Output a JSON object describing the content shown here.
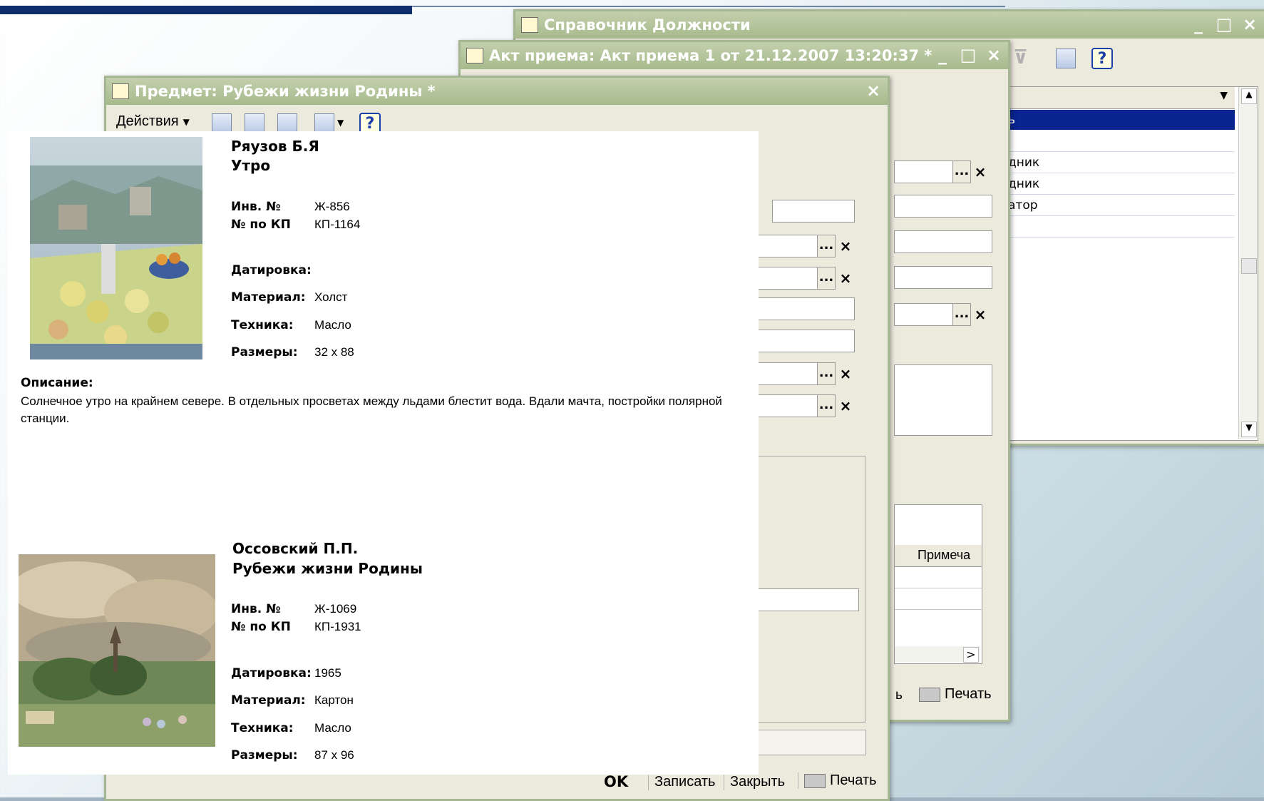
{
  "windows": {
    "sprav": {
      "title": "Справочник Должности",
      "list_items": [
        "ь",
        "",
        "дник",
        "дник",
        "атор",
        ""
      ]
    },
    "akt": {
      "title": "Акт приема: Акт приема 1 от 21.12.2007 13:20:37 *",
      "table_header": "Примеча",
      "buttons": {
        "partial": "ь",
        "print": "Печать"
      }
    },
    "predmet": {
      "title": "Предмет: Рубежи жизни Родины *",
      "actions_menu": "Действия",
      "buttons": {
        "ok": "OK",
        "save": "Записать",
        "close": "Закрыть",
        "print": "Печать"
      }
    }
  },
  "labels": {
    "inv": "Инв. №",
    "kp": "№ по КП",
    "dating": "Датировка:",
    "material": "Материал:",
    "technique": "Техника:",
    "dimensions": "Размеры:",
    "description": "Описание:"
  },
  "items": [
    {
      "author": "Ряузов Б.Я",
      "title": "Утро",
      "inv": "Ж-856",
      "kp": "КП-1164",
      "dating": "",
      "material": "Холст",
      "technique": "Масло",
      "dimensions": "32 х 88",
      "description": "Солнечное утро на крайнем севере. В отдельных просветах между льдами блестит вода. Вдали мачта, постройки полярной станции."
    },
    {
      "author": "Оссовский П.П.",
      "title": "Рубежи жизни Родины",
      "inv": "Ж-1069",
      "kp": "КП-1931",
      "dating": "1965",
      "material": "Картон",
      "technique": "Масло",
      "dimensions": "87 х 96"
    }
  ],
  "icons": {
    "close": "×",
    "minimize": "_",
    "maximize": "□",
    "select": "...",
    "clear": "×",
    "help": "?",
    "scroll_right": ">",
    "scroll_up": "▲",
    "scroll_down": "▼"
  }
}
